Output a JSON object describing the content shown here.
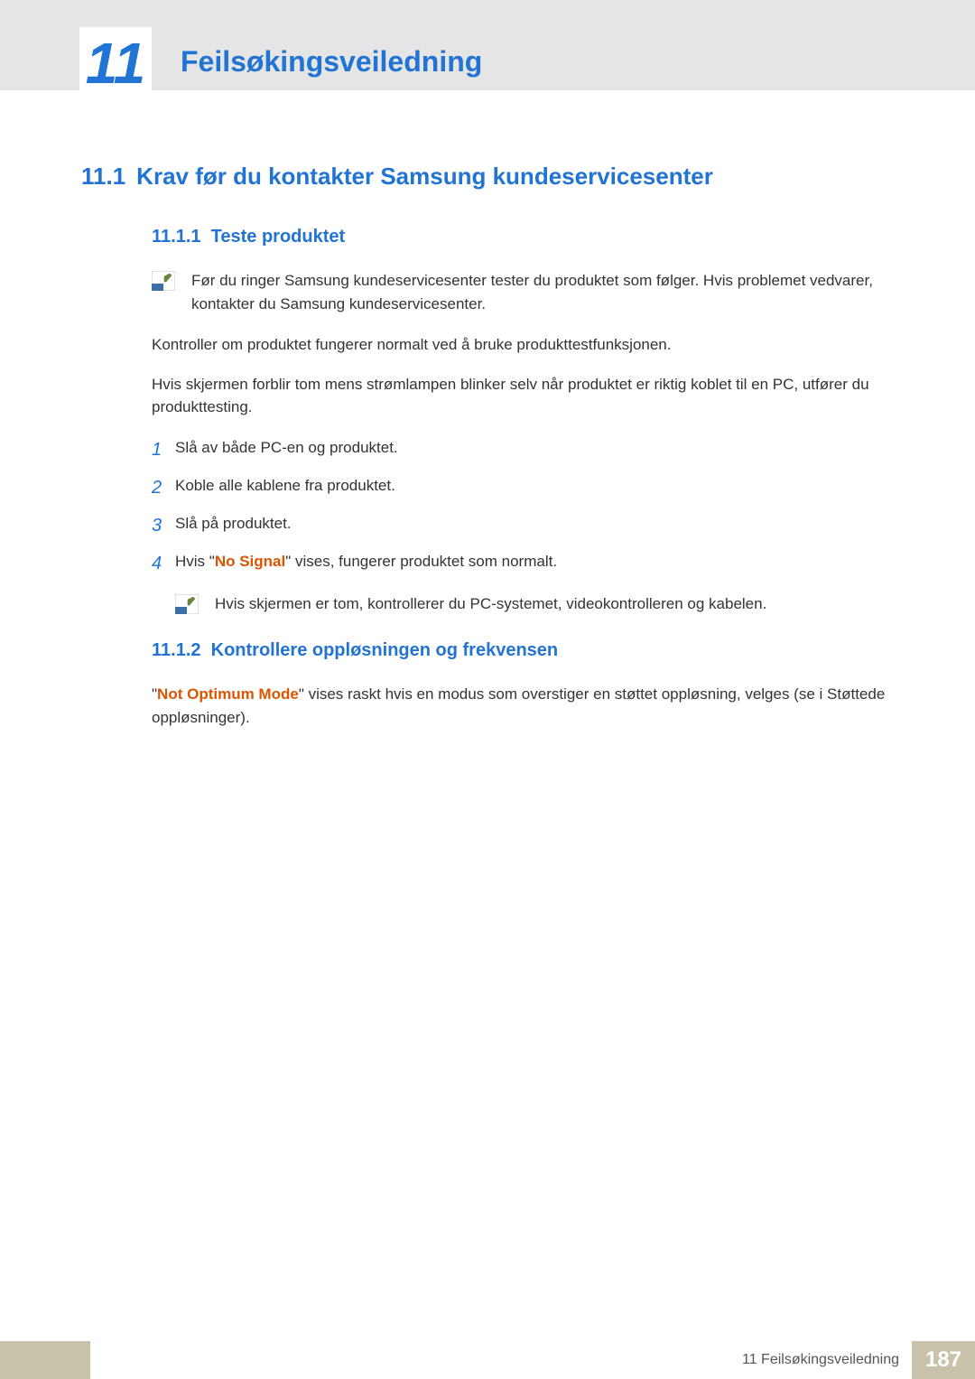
{
  "chapter": {
    "number": "11",
    "title": "Feilsøkingsveiledning"
  },
  "section": {
    "number": "11.1",
    "title": "Krav før du kontakter Samsung kundeservicesenter"
  },
  "sub1": {
    "number": "11.1.1",
    "title": "Teste produktet"
  },
  "note1": "Før du ringer Samsung kundeservicesenter tester du produktet som følger. Hvis problemet vedvarer, kontakter du Samsung kundeservicesenter.",
  "body1": "Kontroller om produktet fungerer normalt ved å bruke produkttestfunksjonen.",
  "body2": "Hvis skjermen forblir tom mens strømlampen blinker selv når produktet er riktig koblet til en PC, utfører du produkttesting.",
  "steps": {
    "s1": "Slå av både PC-en og produktet.",
    "s2": "Koble alle kablene fra produktet.",
    "s3": "Slå på produktet.",
    "s4_pre": "Hvis \"",
    "s4_h": "No Signal",
    "s4_post": "\" vises, fungerer produktet som normalt."
  },
  "nested_note": "Hvis skjermen er tom, kontrollerer du PC-systemet, videokontrolleren og kabelen.",
  "sub2": {
    "number": "11.1.2",
    "title": "Kontrollere oppløsningen og frekvensen"
  },
  "body3_pre": "\"",
  "body3_h": "Not Optimum Mode",
  "body3_post": "\" vises raskt hvis en modus som overstiger en støttet oppløsning, velges (se i Støttede oppløsninger).",
  "footer": {
    "chapterText": "11 Feilsøkingsveiledning",
    "page": "187"
  }
}
